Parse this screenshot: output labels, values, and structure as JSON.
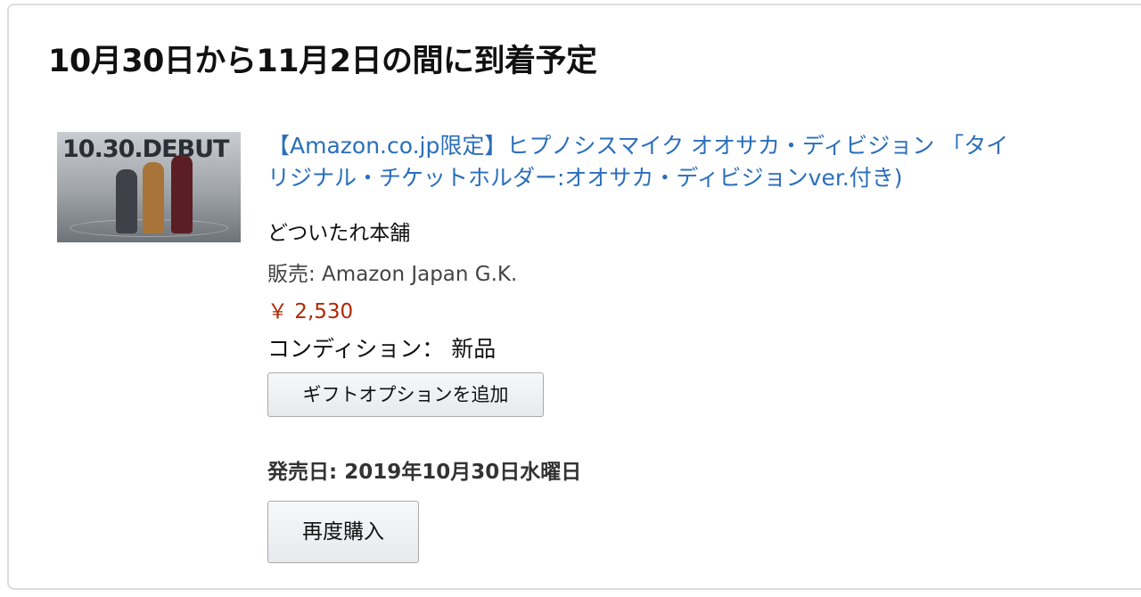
{
  "delivery": {
    "title": "10月30日から11月2日の間に到着予定"
  },
  "item": {
    "thumbnail": {
      "caption": "10.30.DEBUT"
    },
    "title_line1": "【Amazon.co.jp限定】ヒプノシスマイク オオサカ・ディビジョン 「タイ",
    "title_line2": "リジナル・チケットホルダー:オオサカ・ディビジョンver.付き)",
    "author": "どついたれ本舗",
    "seller": "販売: Amazon Japan G.K.",
    "price": "￥ 2,530",
    "condition": "コンディション： 新品",
    "gift_button_label": "ギフトオプションを追加",
    "release_date": "発売日: 2019年10月30日水曜日",
    "rebuy_button_label": "再度購入"
  },
  "colors": {
    "link": "#2a6ebb",
    "price": "#b12704",
    "border": "#dddddd"
  }
}
